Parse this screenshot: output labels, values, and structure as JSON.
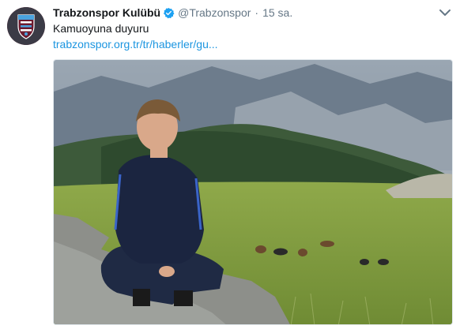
{
  "tweet": {
    "display_name": "Trabzonspor Kulübü",
    "handle": "@Trabzonspor",
    "separator": "·",
    "time": "15 sa.",
    "text": "Kamuoyuna duyuru",
    "link": "trabzonspor.org.tr/tr/haberler/gu..."
  },
  "icons": {
    "verified": "verified-badge-icon",
    "more": "chevron-down-icon",
    "avatar": "trabzonspor-crest"
  },
  "colors": {
    "link": "#1b95e0",
    "muted": "#657786",
    "verified": "#1da1f2",
    "club_primary": "#6b1a2e",
    "club_secondary": "#4aa3df"
  }
}
